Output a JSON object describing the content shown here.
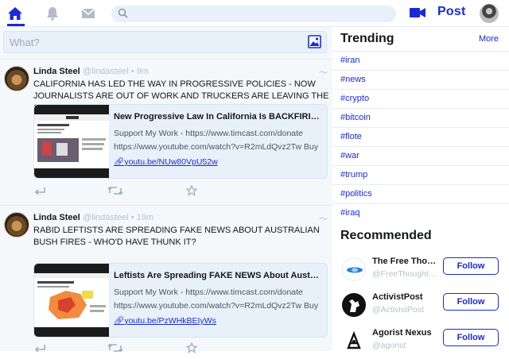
{
  "header": {
    "nav": [
      "home-icon",
      "bell-icon",
      "mail-icon"
    ],
    "search_placeholder": "",
    "post_label": "Post",
    "accent": "#1a2ad8"
  },
  "compose": {
    "placeholder": "What?"
  },
  "posts": [
    {
      "name": "Linda Steel",
      "handle": "@lindasteel • 9m",
      "text": "CALIFORNIA HAS LED THE WAY IN PROGRESSIVE POLICIES - NOW JOURNALISTS ARE OUT OF WORK AND TRUCKERS ARE LEAVING THE STATE!",
      "card": {
        "title": "New Progressive Law In California Is BACKFIRING On Journalists",
        "line1": "Support My Work - https://www.timcast.com/donate",
        "line2": "https://www.youtube.com/watch?v=R2mLdQvz2Tw Buy",
        "link": "youtu.be/NUw80VpU52w"
      }
    },
    {
      "name": "Linda Steel",
      "handle": "@lindasteel • 19m",
      "text": "RABID LEFTISTS ARE SPREADING FAKE NEWS ABOUT AUSTRALIAN BUSH FIRES - WHO'D HAVE THUNK IT?",
      "card": {
        "title": "Leftists Are Spreading FAKE NEWS About Australia Fires",
        "line1": "Support My Work - https://www.timcast.com/donate",
        "line2": "https://www.youtube.com/watch?v=R2mLdQvz2Tw Buy",
        "link": "youtu.be/PzWHkBEIyWs"
      }
    }
  ],
  "trending": {
    "title": "Trending",
    "more": "More",
    "tags": [
      "#iran",
      "#news",
      "#crypto",
      "#bitcoin",
      "#flote",
      "#war",
      "#trump",
      "#politics",
      "#iraq"
    ]
  },
  "recommended": {
    "title": "Recommended",
    "follow_label": "Follow",
    "accounts": [
      {
        "name": "The Free Thought Project",
        "handle": "@FreeThoughtProject"
      },
      {
        "name": "ActivistPost",
        "handle": "@ActivistPost"
      },
      {
        "name": "Agorist Nexus",
        "handle": "@agorist"
      }
    ]
  }
}
